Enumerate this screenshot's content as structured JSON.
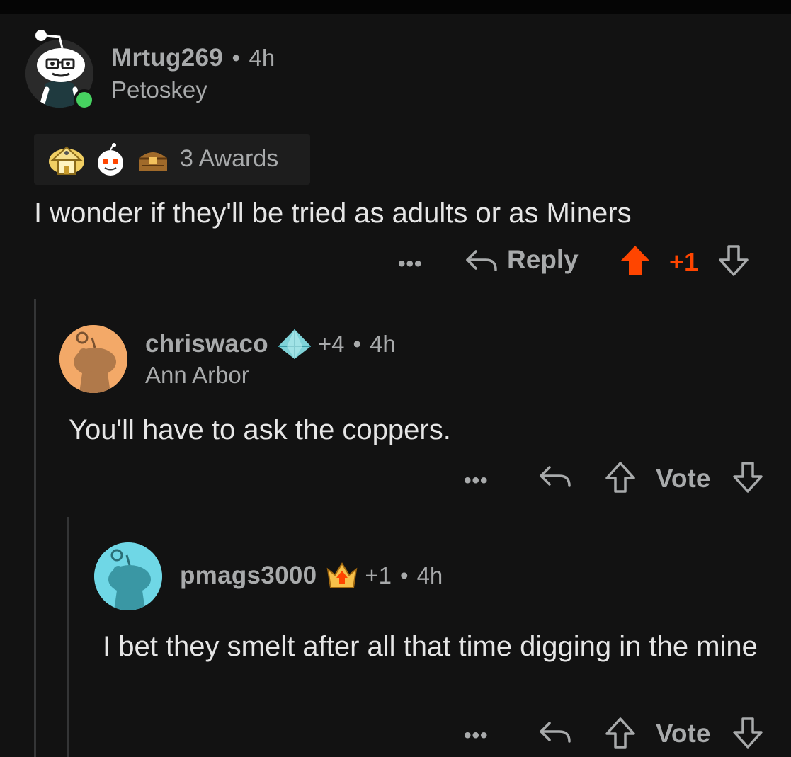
{
  "comments": [
    {
      "username": "Mrtug269",
      "time": "4h",
      "flair": "Petoskey",
      "awards_label": "3 Awards",
      "awards": [
        "golden-house-award-icon",
        "snoo-award-icon",
        "treasure-chest-award-icon"
      ],
      "text": "I wonder if they'll be tried as adults or as Miners",
      "more": "•••",
      "reply_label": "Reply",
      "score": "+1",
      "vote_state": "upvoted"
    },
    {
      "username": "chriswaco",
      "score_badge": "+4",
      "time": "4h",
      "flair": "Ann Arbor",
      "text": "You'll have to ask the coppers.",
      "more": "•••",
      "vote_label": "Vote"
    },
    {
      "username": "pmags3000",
      "score_badge": "+1",
      "time": "4h",
      "text": "I bet they smelt after all that time digging in the mine",
      "more": "•••",
      "vote_label": "Vote"
    }
  ],
  "separator": "•",
  "colors": {
    "background": "#121212",
    "upvote": "#ff4500",
    "online": "#46d160",
    "avatar2_bg": "#f3a968",
    "avatar3_bg": "#6fd7e6",
    "muted": "#a8aaab"
  }
}
